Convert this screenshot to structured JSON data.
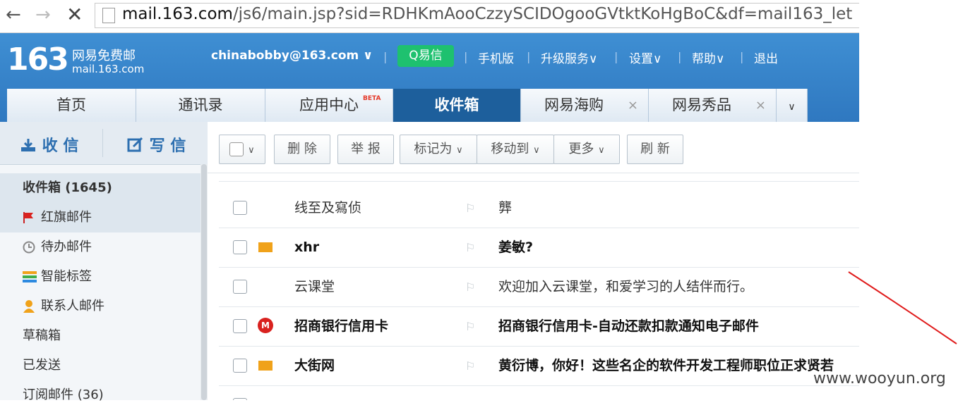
{
  "browser": {
    "back_icon": "←",
    "forward_icon": "→",
    "stop_icon": "✕",
    "url_host": "mail.163.com",
    "url_rest": "/js6/main.jsp?sid=RDHKmAooCzzySCIDOgooGVtktKoHgBoC&df=mail163_let"
  },
  "header": {
    "logo_num": "163",
    "logo_cn": "网易免费邮",
    "logo_domain": "mail.163.com",
    "user": "chinabobby@163.com",
    "user_arrow": "∨",
    "yixin": "易信",
    "yixin_icon": "Q",
    "links": [
      "手机版",
      "升级服务",
      "设置",
      "帮助",
      "退出"
    ],
    "dropdown_arrow": "∨",
    "sep": "|"
  },
  "tabs": {
    "items": [
      "首页",
      "通讯录",
      "应用中心",
      "收件箱",
      "网易海购",
      "网易秀品"
    ],
    "beta": "BETA",
    "close": "×",
    "more": "∨"
  },
  "sidebar": {
    "receive": "收 信",
    "write": "写 信",
    "folders": [
      {
        "label": "收件箱 (1645)"
      },
      {
        "label": "红旗邮件"
      },
      {
        "label": "待办邮件"
      },
      {
        "label": "智能标签"
      },
      {
        "label": "联系人邮件"
      },
      {
        "label": "草稿箱"
      },
      {
        "label": "已发送"
      },
      {
        "label": "订阅邮件 (36)"
      }
    ]
  },
  "toolbar": {
    "buttons": [
      "删 除",
      "举 报",
      "标记为",
      "移动到",
      "更多",
      "刷 新"
    ],
    "arrow": "∨"
  },
  "mails": [
    {
      "sender": "线至及寫侦",
      "subject": "龏",
      "unread": false,
      "icon": ""
    },
    {
      "sender": "xhr",
      "subject": "姜敏?",
      "unread": true,
      "icon": "envelope"
    },
    {
      "sender": "云课堂",
      "subject": "欢迎加入云课堂，和爱学习的人结伴而行。",
      "unread": false,
      "icon": ""
    },
    {
      "sender": "招商银行信用卡",
      "subject": "招商银行信用卡-自动还款扣款通知电子邮件",
      "unread": true,
      "icon": "bank"
    },
    {
      "sender": "大街网",
      "subject": "黄衍博，你好！这些名企的软件开发工程师职位正求贤若",
      "unread": true,
      "icon": "envelope"
    }
  ],
  "flag_glyph": "⚐",
  "watermark": "www.wooyun.org"
}
